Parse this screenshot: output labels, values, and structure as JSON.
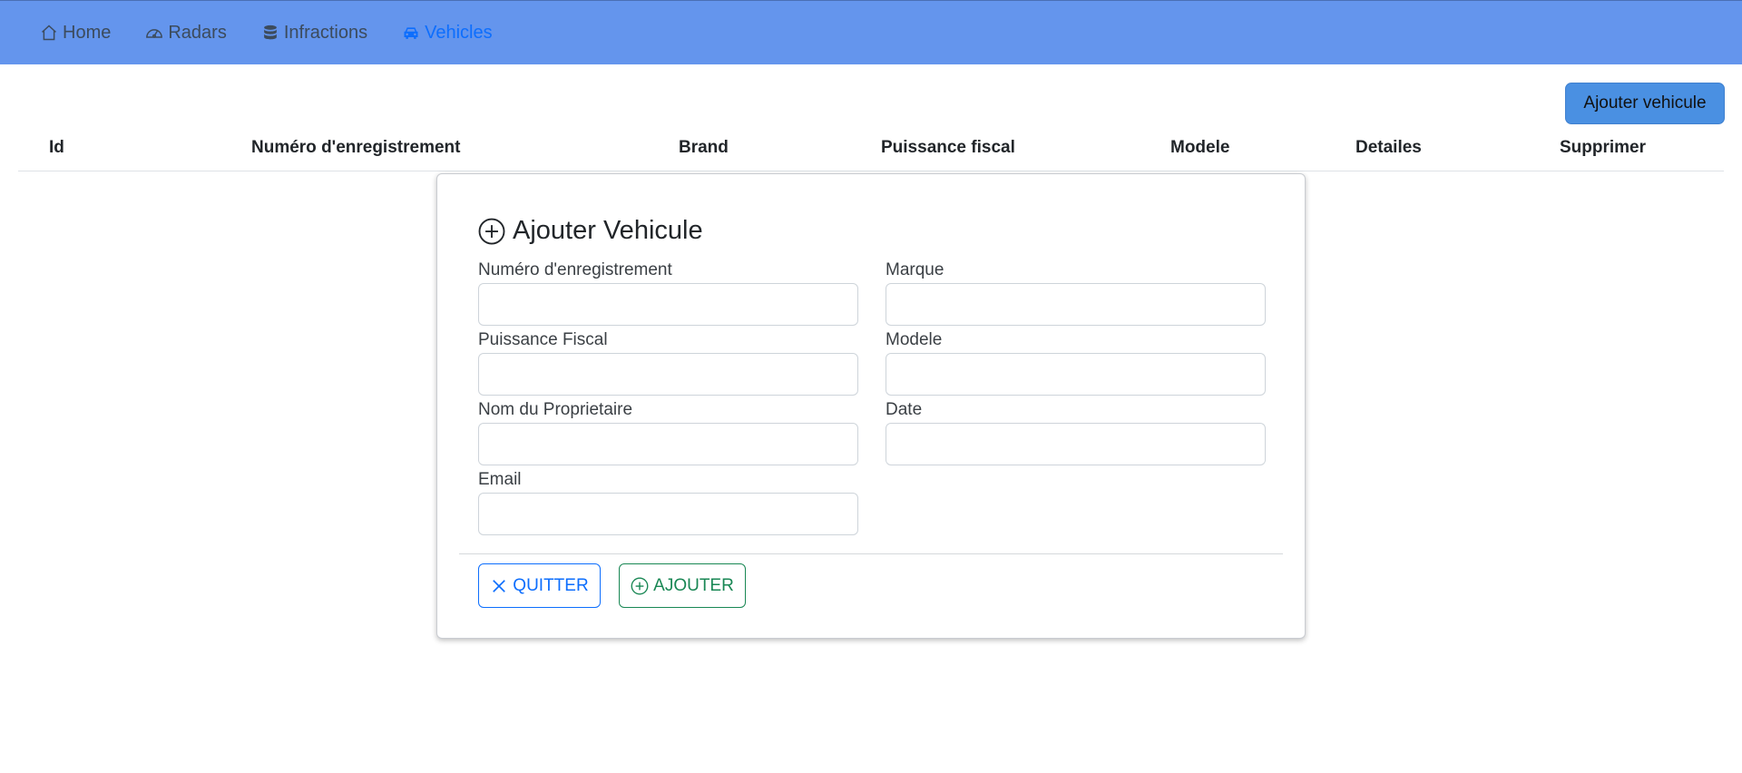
{
  "nav": {
    "items": [
      {
        "label": "Home",
        "icon": "house-icon"
      },
      {
        "label": "Radars",
        "icon": "speedometer-icon"
      },
      {
        "label": "Infractions",
        "icon": "database-icon"
      },
      {
        "label": "Vehicles",
        "icon": "car-icon",
        "active": true
      }
    ],
    "active_color": "#0d6efd",
    "bg_color": "#6495ed"
  },
  "toolbar": {
    "add_vehicle_label": "Ajouter vehicule"
  },
  "table": {
    "columns": [
      "Id",
      "Numéro d'enregistrement",
      "Brand",
      "Puissance fiscal",
      "Modele",
      "Detailes",
      "Supprimer"
    ]
  },
  "modal": {
    "title": "Ajouter Vehicule",
    "fields": {
      "registration": {
        "label": "Numéro d'enregistrement",
        "value": ""
      },
      "brand": {
        "label": "Marque",
        "value": ""
      },
      "fiscal_power": {
        "label": "Puissance Fiscal",
        "value": ""
      },
      "model": {
        "label": "Modele",
        "value": ""
      },
      "owner_name": {
        "label": "Nom du Proprietaire",
        "value": ""
      },
      "date": {
        "label": "Date",
        "value": ""
      },
      "email": {
        "label": "Email",
        "value": ""
      }
    },
    "quit_label": "QUITTER",
    "add_label": "AJOUTER"
  }
}
